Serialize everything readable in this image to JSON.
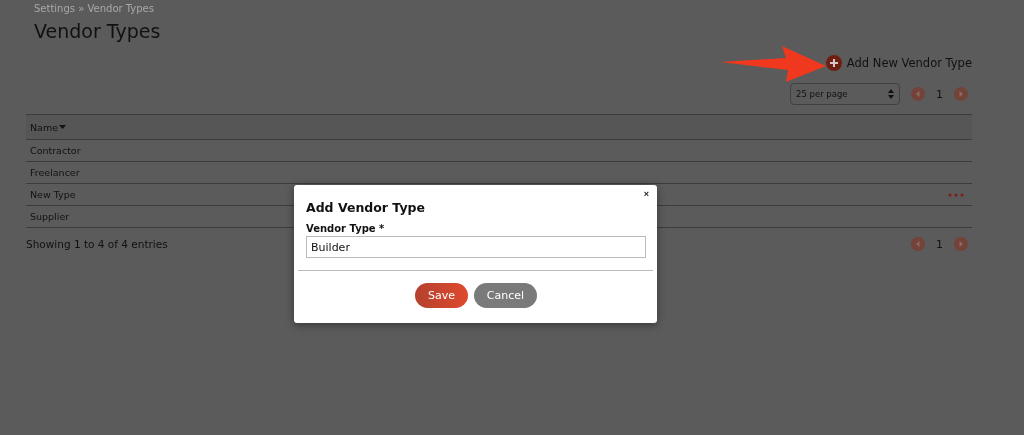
{
  "breadcrumb": "Settings » Vendor Types",
  "title": "Vendor Types",
  "add_link": "Add New Vendor Type",
  "per_page": "25 per page",
  "pager_top": {
    "page": "1"
  },
  "table": {
    "columns": [
      {
        "label": "Name",
        "sorted": true
      }
    ],
    "rows": [
      {
        "name": "Contractor",
        "hovered": false
      },
      {
        "name": "Freelancer",
        "hovered": false
      },
      {
        "name": "New Type",
        "hovered": true
      },
      {
        "name": "Supplier",
        "hovered": false
      }
    ]
  },
  "footer": {
    "info": "Showing 1 to 4 of 4 entries",
    "page": "1"
  },
  "modal": {
    "title": "Add Vendor Type",
    "close": "×",
    "field_label": "Vendor Type *",
    "field_value": "Builder",
    "buttons": [
      {
        "label": "Save",
        "kind": "primary"
      },
      {
        "label": "Cancel",
        "kind": "secondary"
      }
    ]
  }
}
